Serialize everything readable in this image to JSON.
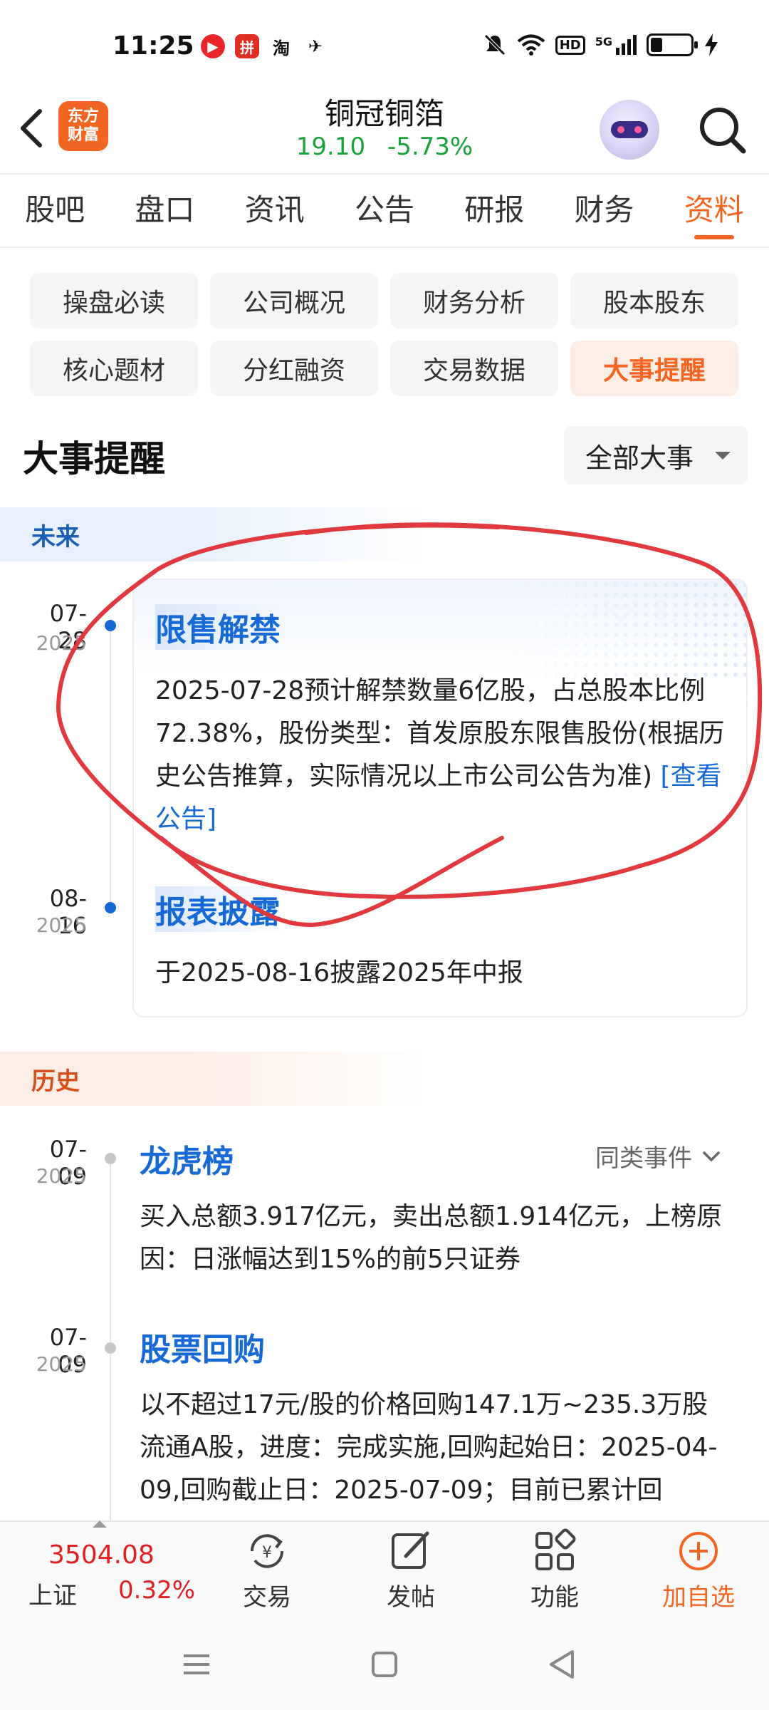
{
  "status_bar": {
    "time": "11:25",
    "app_icons": [
      {
        "name": "video-app-icon",
        "color": "#e8262c",
        "glyph": "▶"
      },
      {
        "name": "pinduoduo-icon",
        "color": "#e02e24",
        "glyph": "拼"
      },
      {
        "name": "taobao-icon",
        "color": "#ffffff",
        "glyph": "淘"
      },
      {
        "name": "leaf-app-icon",
        "color": "#ffffff",
        "glyph": "✈"
      }
    ],
    "network_label": "HD",
    "signal_label": "5G"
  },
  "header": {
    "logo_line1": "东方",
    "logo_line2": "财富",
    "stock_name": "铜冠铜箔",
    "price": "19.10",
    "change_pct": "-5.73%",
    "price_color": "#1aa33a"
  },
  "tabs": [
    {
      "label": "股吧"
    },
    {
      "label": "盘口"
    },
    {
      "label": "资讯"
    },
    {
      "label": "公告"
    },
    {
      "label": "研报"
    },
    {
      "label": "财务"
    },
    {
      "label": "资料",
      "active": true
    }
  ],
  "subtabs": [
    {
      "label": "操盘必读"
    },
    {
      "label": "公司概况"
    },
    {
      "label": "财务分析"
    },
    {
      "label": "股本股东"
    },
    {
      "label": "核心题材"
    },
    {
      "label": "分红融资"
    },
    {
      "label": "交易数据"
    },
    {
      "label": "大事提醒",
      "active": true
    }
  ],
  "section": {
    "title": "大事提醒",
    "filter_label": "全部大事"
  },
  "future": {
    "label": "未来",
    "events": [
      {
        "date": "07-28",
        "year": "2025",
        "title": "限售解禁",
        "body": "2025-07-28预计解禁数量6亿股，占总股本比例72.38%，股份类型：首发原股东限售股份(根据历史公告推算，实际情况以上市公司公告为准)",
        "link": "[查看公告]"
      },
      {
        "date": "08-16",
        "year": "2025",
        "title": "报表披露",
        "body": "于2025-08-16披露2025年中报"
      }
    ]
  },
  "history": {
    "label": "历史",
    "same_type_label": "同类事件",
    "events": [
      {
        "date": "07-09",
        "year": "2025",
        "title": "龙虎榜",
        "body": "买入总额3.917亿元，卖出总额1.914亿元，上榜原因：日涨幅达到15%的前5只证券"
      },
      {
        "date": "07-09",
        "year": "2025",
        "title": "股票回购",
        "body": "以不超过17元/股的价格回购147.1万~235.3万股流通A股，进度：完成实施,回购起始日：2025-04-09,回购截止日：2025-07-09；目前已累计回"
      }
    ]
  },
  "bottom_bar": {
    "index_value": "3504.08",
    "index_name": "上证",
    "index_pct": "0.32%",
    "items": [
      {
        "label": "交易"
      },
      {
        "label": "发帖"
      },
      {
        "label": "功能"
      },
      {
        "label": "加自选"
      }
    ]
  },
  "colors": {
    "accent": "#f26522",
    "link_blue": "#1769d6",
    "up_red": "#e02020",
    "annotation_red": "#e0393e"
  }
}
